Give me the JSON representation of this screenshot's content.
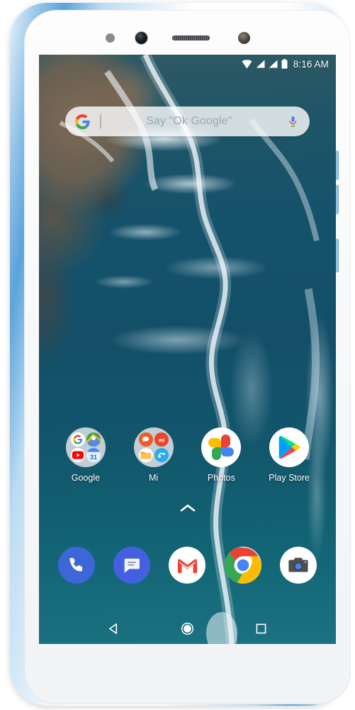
{
  "device": {
    "name": "Xiaomi Mi A2 smartphone",
    "body_color": "#8ec0e6",
    "bezel_color": "#fdfdfd",
    "hardware": {
      "sensor": "proximity-sensor",
      "front_camera": "front-camera",
      "earpiece": "earpiece-speaker",
      "led": "notification-led",
      "volume_up": "volume-up-button",
      "volume_down": "volume-down-button",
      "power": "power-button"
    }
  },
  "status_bar": {
    "time": "8:16 AM",
    "icons": [
      "wifi-icon",
      "signal-icon-1",
      "signal-icon-2",
      "battery-icon"
    ],
    "text_color": "#ffffff"
  },
  "search": {
    "placeholder": "Say \"Ok Google\"",
    "logo": "google-g-icon",
    "mic": "mic-icon",
    "background": "rgba(255,255,255,0.80)",
    "text_color": "#9aa7ae"
  },
  "home": {
    "wallpaper": {
      "name": "aerial-coastline-wallpaper",
      "ocean_color": "#134f68",
      "land_color": "#836a54",
      "foam_color": "#eef4f7"
    },
    "apps": [
      {
        "label": "Google",
        "icon": "google-folder-icon",
        "type": "folder",
        "contents": [
          "google-search-icon",
          "google-maps-icon",
          "youtube-icon",
          "google-calendar-icon"
        ]
      },
      {
        "label": "Mi",
        "icon": "mi-folder-icon",
        "type": "folder",
        "contents": [
          "mi-community-icon",
          "mi-store-icon",
          "mi-file-manager-icon",
          "mi-drop-icon"
        ]
      },
      {
        "label": "Photos",
        "icon": "google-photos-icon",
        "type": "app"
      },
      {
        "label": "Play Store",
        "icon": "google-play-store-icon",
        "type": "app"
      }
    ],
    "drawer_handle": "chevron-up-icon",
    "dock": [
      {
        "name": "Phone",
        "icon": "phone-icon",
        "color": "#3d67d8"
      },
      {
        "name": "Messages",
        "icon": "messages-icon",
        "color": "#4460e0"
      },
      {
        "name": "Gmail",
        "icon": "gmail-icon",
        "color": "#ffffff"
      },
      {
        "name": "Chrome",
        "icon": "chrome-icon",
        "color": "#ffffff"
      },
      {
        "name": "Camera",
        "icon": "camera-icon",
        "color": "#ffffff"
      }
    ]
  },
  "nav_bar": {
    "back": "back-triangle-icon",
    "home": "home-circle-icon",
    "recents": "recents-square-icon"
  }
}
